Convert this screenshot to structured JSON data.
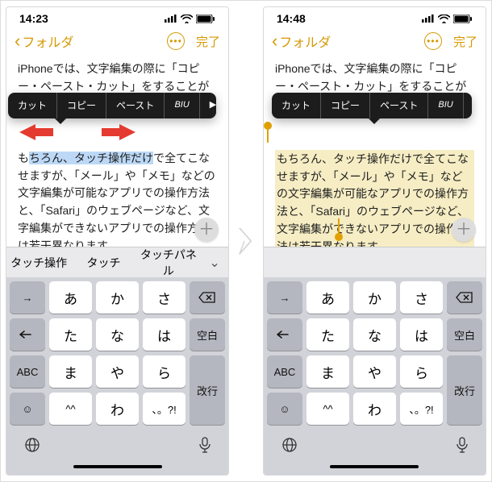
{
  "screens": {
    "left": {
      "time": "14:23",
      "back": "フォルダ",
      "done": "完了",
      "p1": "iPhoneでは、文字編集の際に「コピー・ペースト・カット」をすることができます",
      "menu": {
        "cut": "カット",
        "copy": "コピー",
        "paste": "ペースト",
        "biu": "BIU",
        "more": "▶"
      },
      "line_pre": "も",
      "line_sel": "ちろん、タッチ操作だけ",
      "line_post": "で全てこなせ",
      "p2b": "ますが、「メール」や「メモ」などの文字編集が可能なアプリでの操作方法と、「Safari」のウェブページなど、文字編集ができないアプリでの操作方法は若干異なります。",
      "predict": {
        "a": "タッチ操作",
        "b": "タッチ",
        "c": "タッチパネル"
      }
    },
    "right": {
      "time": "14:48",
      "back": "フォルダ",
      "done": "完了",
      "p1": "iPhoneでは、文字編集の際に「コピー・ペースト・カット」をすることができます",
      "menu": {
        "cut": "カット",
        "copy": "コピー",
        "paste": "ペースト",
        "biu": "BIU",
        "more": "▶"
      },
      "p2": "もちろん、タッチ操作だけで全てこなせますが、「メール」や「メモ」などの文字編集が可能なアプリでの操作方法と、「Safari」のウェブページなど、文字編集ができないアプリでの操作方法は若干異なります。"
    }
  },
  "keys": {
    "arrow": "→",
    "a": "あ",
    "ka": "か",
    "sa": "さ",
    "ta": "た",
    "na": "な",
    "ha": "は",
    "ma": "ま",
    "ya": "や",
    "ra": "ら",
    "bar": "⁠—",
    "wa": "^^",
    "wo": "わ",
    "punc": "、。?!",
    "abc": "ABC",
    "space": "空白",
    "enter": "改行"
  }
}
